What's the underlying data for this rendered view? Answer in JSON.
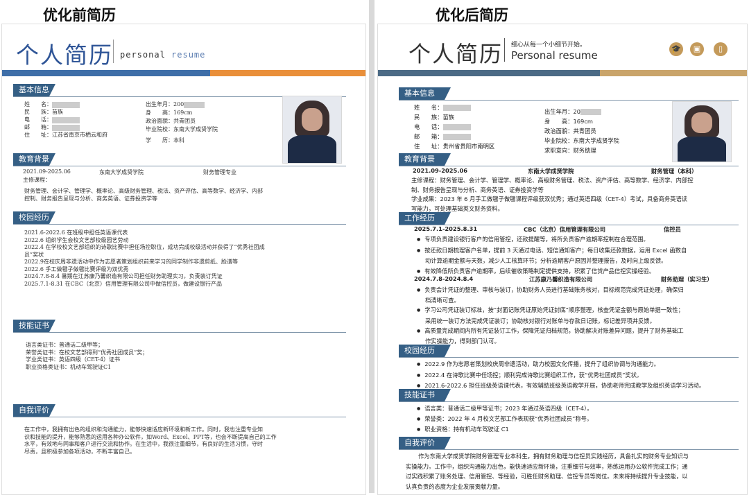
{
  "captions": {
    "before": "优化前简历",
    "after": "优化后简历"
  },
  "left": {
    "title": "个人简历",
    "subtitle_a": "personal",
    "subtitle_b": "resume",
    "sections": {
      "basic": "基本信息",
      "edu": "教育背景",
      "campus": "校园经历",
      "skills": "技能证书",
      "self": "自我评价"
    },
    "basic": {
      "name_label": "姓　　名：",
      "ethnic_label": "民　　族：",
      "ethnic_value": "苗族",
      "phone_label": "电　　话：",
      "email_label": "邮　　箱：",
      "addr_label": "住　　址：",
      "addr_value": "江苏省南京市栖云和府",
      "birth_label": "出生年月：",
      "birth_value": "200",
      "height_label": "身　　高：",
      "height_value": "169cm",
      "politics_label": "政治面貌：",
      "politics_value": "共青团员",
      "school_label": "毕业院校：",
      "school_value": "东南大学成贤学院",
      "degree_label": "学　　历：",
      "degree_value": "本科"
    },
    "edu": {
      "period": "2021.09-2025.06",
      "school": "东南大学成贤学院",
      "major": "财务管理专业",
      "courses_label": "主修课程：",
      "courses_line1": "财务管理、会计学、管理学、概率论、高级财务管理、税法、资产评估、高等数学、经济学、内部",
      "courses_line2": "控制、财务报告呈现与分析、商务英语、证券投资学等"
    },
    "campus": [
      "2021.6-2022.6  在班级中担任英语课代表",
      "2022.6  组织学生会校文艺部校级园艺劳动",
      "2022.4  在学校校文艺部组织的诗歌比赛中担任场控职位，成功完成校级活动并获得了“优秀社团成",
      "员”奖状",
      "2022.9在校庆周非遗活动中作为志愿者策划组织前来学习的同学制作非遗剪纸、脸谱等",
      "2022.6  手工做毽子做毽比赛评级为双优秀",
      "2024.7.8-8.4  暑期在江苏康乃馨织造有限公司担任财务助理实习，负责装订凭证",
      "2025.7.1-8.31  在CBC（北京）信用管理有限公司中做信控员，做建设银行产品"
    ],
    "skills": [
      "语言类证书：普通话二级甲等；",
      "荣誉类证书：在校文艺部得到“优秀社团成员”奖；",
      "学业类证书：英语四级（CET-4）证书",
      "职业资格类证书：机动车驾驶证C1"
    ],
    "self": [
      "在工作中，我拥有出色的组织和沟通能力，能够快速适应新环境和新工作。同时，我也注重专业知",
      "识和技能的提升，能够熟悉的运用各种办公软件，如Word、Excel、PPT等，也会不断提高自己的工作",
      "水平，有效地与同事和客户进行交流和协作。在生活中，我很注重细节，有良好的生活习惯，守时",
      "尽责，且积极参加各项活动，不断丰富自己。"
    ]
  },
  "right": {
    "title": "个人简历",
    "tagline": "细心从每一个小细节开始。",
    "subtitle": "Personal resume",
    "sections": {
      "basic": "基本信息",
      "edu": "教育背景",
      "work": "工作经历",
      "campus": "校园经历",
      "skills": "技能证书",
      "self": "自我评价"
    },
    "basic": {
      "name_label": "姓　　名：",
      "ethnic_label": "民　　族：",
      "ethnic_value": "苗族",
      "phone_label": "电　　话：",
      "email_label": "邮　　箱：",
      "addr_label": "住　　址：",
      "addr_value": "贵州省贵阳市南明区",
      "birth_label": "出生年月：",
      "birth_value": "20",
      "height_label": "身　　高：",
      "height_value": "169cm",
      "politics_label": "政治面貌：",
      "politics_value": "共青团员",
      "school_label": "毕业院校：",
      "school_value": "东南大学成贤学院",
      "intent_label": "求职意向：",
      "intent_value": "财务助理"
    },
    "edu": {
      "period": "2021.09-2025.06",
      "school": "东南大学成贤学院",
      "major": "财务管理（本科）",
      "courses_line1": "主修课程：财务管理、会计学、管理学、概率论、高级财务管理、税法、资产评估、高等数学、经济学、内部控",
      "courses_line2": "制、财务报告呈现与分析、商务英语、证券投资学等",
      "result_line1": "学业成果：2023 年 6 月手工做毽子做毽课程评级获双优秀；通过英语四级（CET-4）考试，具备商务英语读",
      "result_line2": "写能力，可处理基础英文财务资料。"
    },
    "work": [
      {
        "period": "2025.7.1-2025.8.31",
        "company": "CBC（北京）信用管理有限公司",
        "role": "信控员",
        "bullets": [
          [
            "专项负责建设银行客户的信用管控，还款提醒等，将所负责客户逾期率控制在合理范围。"
          ],
          [
            "按还款日期梳理客户名单，提前 3 天通过电话、短信通知客户；每日收集还款数据，运用 Excel 函数自",
            "动计算逾期金额与天数，减少人工核算环节；分析逾期客户原因并整理报告，及时向上级反馈。"
          ],
          [
            "有效降低所负责客户逾期率，后续催收策略制定提供支持，积累了信贷产品信控实操经验。"
          ]
        ]
      },
      {
        "period": "2024.7.8-2024.8.4",
        "company": "江苏康乃馨织造有限公司",
        "role": "财务助理（实习生）",
        "bullets": [
          [
            "负责会计凭证的整理、审核与装订，协助财务人员进行基础账务核对，目标规范完成凭证处理，确保归",
            "档清晰可查。"
          ],
          [
            "学习公司凭证装订标准，按“封面记账凭证原始凭证封底”顺序整理，核查凭证金额与原始单据一致性；",
            "采用统一装订方法完成凭证装订；协助核对银行对账单与存款日记账，标记差异项并反馈。"
          ],
          [
            "高质量完成期间内所有凭证装订工作，保障凭证归档规范，协助解决对账差异问题，提升了财务基础工",
            "作实操能力，得到部门认可。"
          ]
        ]
      }
    ],
    "campus": [
      "2022.9 作为志愿者策划校庆周非遗活动，助力校园文化传播，提升了组织协调与沟通能力。",
      "2022.4 在诗歌比赛中任场控；顺利完成诗歌比赛组织工作，获“优秀社团成员”奖状。",
      "2021.6-2022.6 担任班级英语课代表，有效辅助班级英语教学开展，协助老师完成教学及组织英语学习活动。"
    ],
    "skills": [
      "语言类：普通话二级甲等证书；2023 年通过英语四级（CET-4）。",
      "荣誉类：2022 年 4 月校文艺部工作表现获“优秀社团成员”称号。",
      "职业资格：持有机动车驾驶证 C1"
    ],
    "self": [
      "作为东南大学成贤学院财务管理专业本科生，拥有财务助理与信控员实践经历，具备扎实的财务专业知识与",
      "实操能力。工作中，组织沟通能力出色，能快速适应新环境，注重细节与效率，熟练运用办公软件完成工作；通",
      "过实践积累了账务处理、信用管控、等经验，可胜任财务助理、信控专员等岗位。未来将持续提升专业技能，以",
      "认真负责的态度为企业发展贡献力量。"
    ]
  }
}
